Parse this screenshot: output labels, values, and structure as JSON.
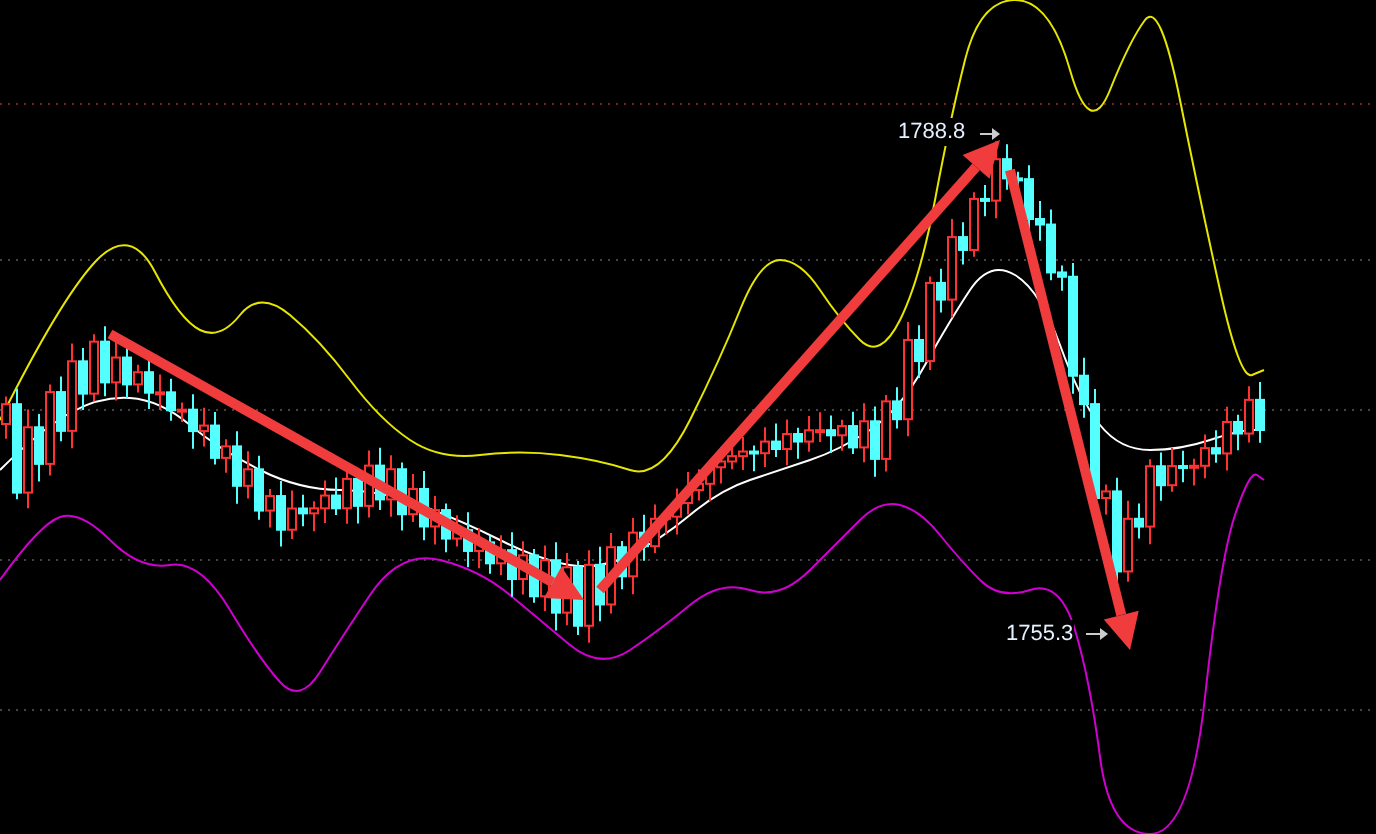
{
  "chart": {
    "price_labels": [
      {
        "text": "1788.8"
      },
      {
        "text": "1755.3"
      }
    ]
  }
}
